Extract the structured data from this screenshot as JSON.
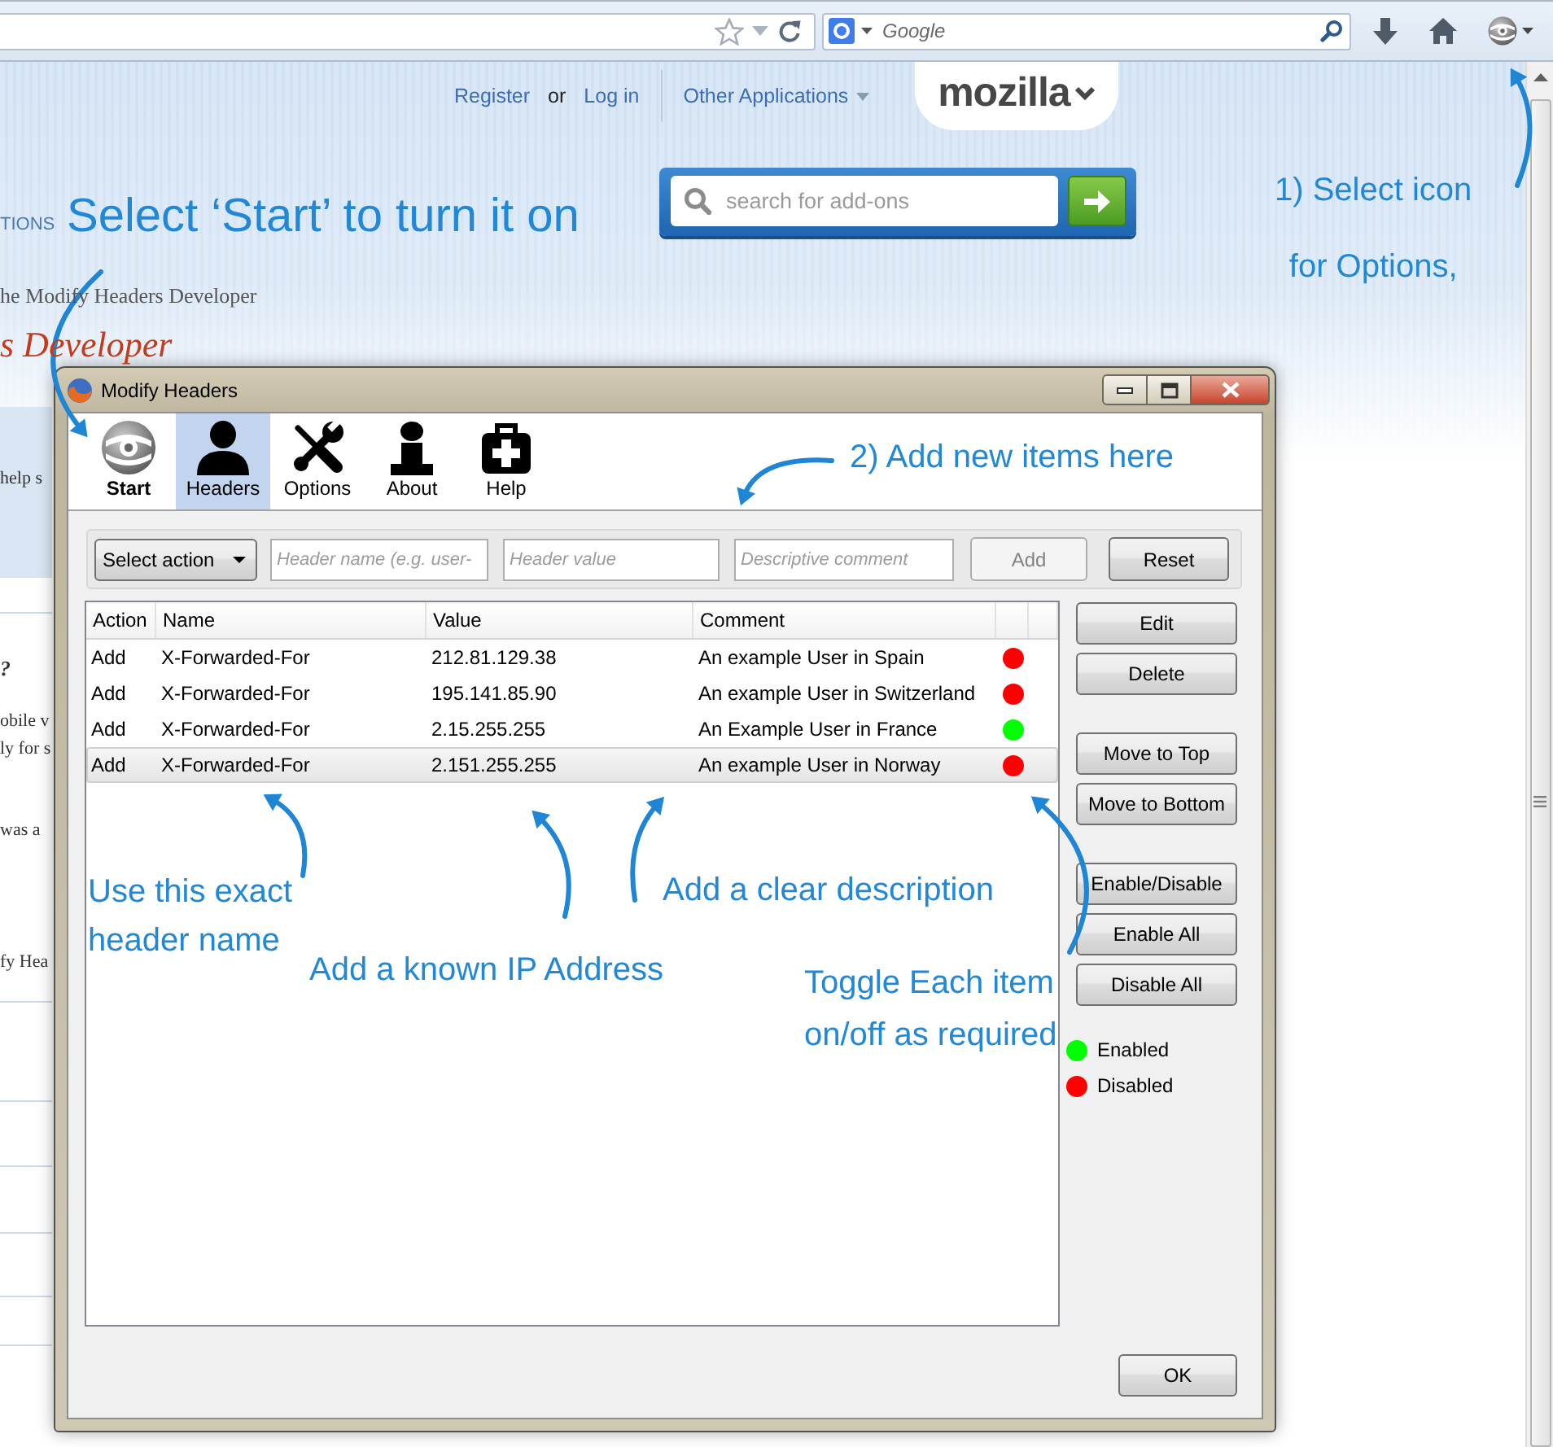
{
  "browser": {
    "search": {
      "placeholder": "Google"
    }
  },
  "page": {
    "nav": [
      {
        "kind": "link",
        "label": "Register"
      },
      {
        "kind": "text",
        "label": "or"
      },
      {
        "kind": "link",
        "label": "Log in"
      },
      {
        "kind": "menu",
        "label": "Other Applications"
      }
    ],
    "logo": "mozilla",
    "section_fragment": "TIONS",
    "search": {
      "placeholder": "search for add-ons"
    },
    "intro_fragment": "he Modify Headers Developer",
    "heading_fragment": "s Developer",
    "side_fragments": [
      "help s",
      "?",
      "obile v",
      "ly for s",
      "was a",
      "fy Hea"
    ]
  },
  "dialog": {
    "title": "Modify Headers",
    "toolbar": [
      {
        "kind": "start",
        "label": "Start",
        "selected": false
      },
      {
        "kind": "headers",
        "label": "Headers",
        "selected": true
      },
      {
        "kind": "options",
        "label": "Options",
        "selected": false
      },
      {
        "kind": "about",
        "label": "About",
        "selected": false
      },
      {
        "kind": "help",
        "label": "Help",
        "selected": false
      }
    ],
    "action_select": {
      "value": "Select action"
    },
    "fields": [
      {
        "placeholder": "Header name (e.g. user-"
      },
      {
        "placeholder": "Header value"
      },
      {
        "placeholder": "Descriptive comment"
      }
    ],
    "form_buttons": [
      {
        "label": "Add",
        "disabled": true
      },
      {
        "label": "Reset",
        "disabled": false
      }
    ],
    "table": {
      "columns": [
        "Action",
        "Name",
        "Value",
        "Comment"
      ],
      "rows": [
        {
          "action": "Add",
          "name": "X-Forwarded-For",
          "value": "212.81.129.38",
          "comment": "An example User in Spain",
          "enabled": false,
          "selected": false
        },
        {
          "action": "Add",
          "name": "X-Forwarded-For",
          "value": "195.141.85.90",
          "comment": "An example User in Switzerland",
          "enabled": false,
          "selected": false
        },
        {
          "action": "Add",
          "name": "X-Forwarded-For",
          "value": "2.15.255.255",
          "comment": "An Example User in France",
          "enabled": true,
          "selected": false
        },
        {
          "action": "Add",
          "name": "X-Forwarded-For",
          "value": "2.151.255.255",
          "comment": "An example User in Norway",
          "enabled": false,
          "selected": true
        }
      ]
    },
    "button_groups": [
      {
        "buttons": [
          "Edit",
          "Delete"
        ]
      },
      {
        "buttons": [
          "Move to Top",
          "Move to Bottom"
        ]
      },
      {
        "buttons": [
          "Enable/Disable",
          "Enable All",
          "Disable All"
        ]
      }
    ],
    "legend": [
      {
        "label": "Enabled",
        "color": "#00ff00"
      },
      {
        "label": "Disabled",
        "color": "#ff0000"
      }
    ],
    "ok_button": "OK"
  },
  "annotations": [
    {
      "text": "Select ‘Start’ to turn it on"
    },
    {
      "text": "1) Select icon\nfor Options,"
    },
    {
      "text": "2) Add new items here"
    },
    {
      "text": "Use this exact\nheader name"
    },
    {
      "text": "Add a clear description"
    },
    {
      "text": "Add a known IP Address"
    },
    {
      "text": "Toggle Each item\non/off as required"
    }
  ]
}
